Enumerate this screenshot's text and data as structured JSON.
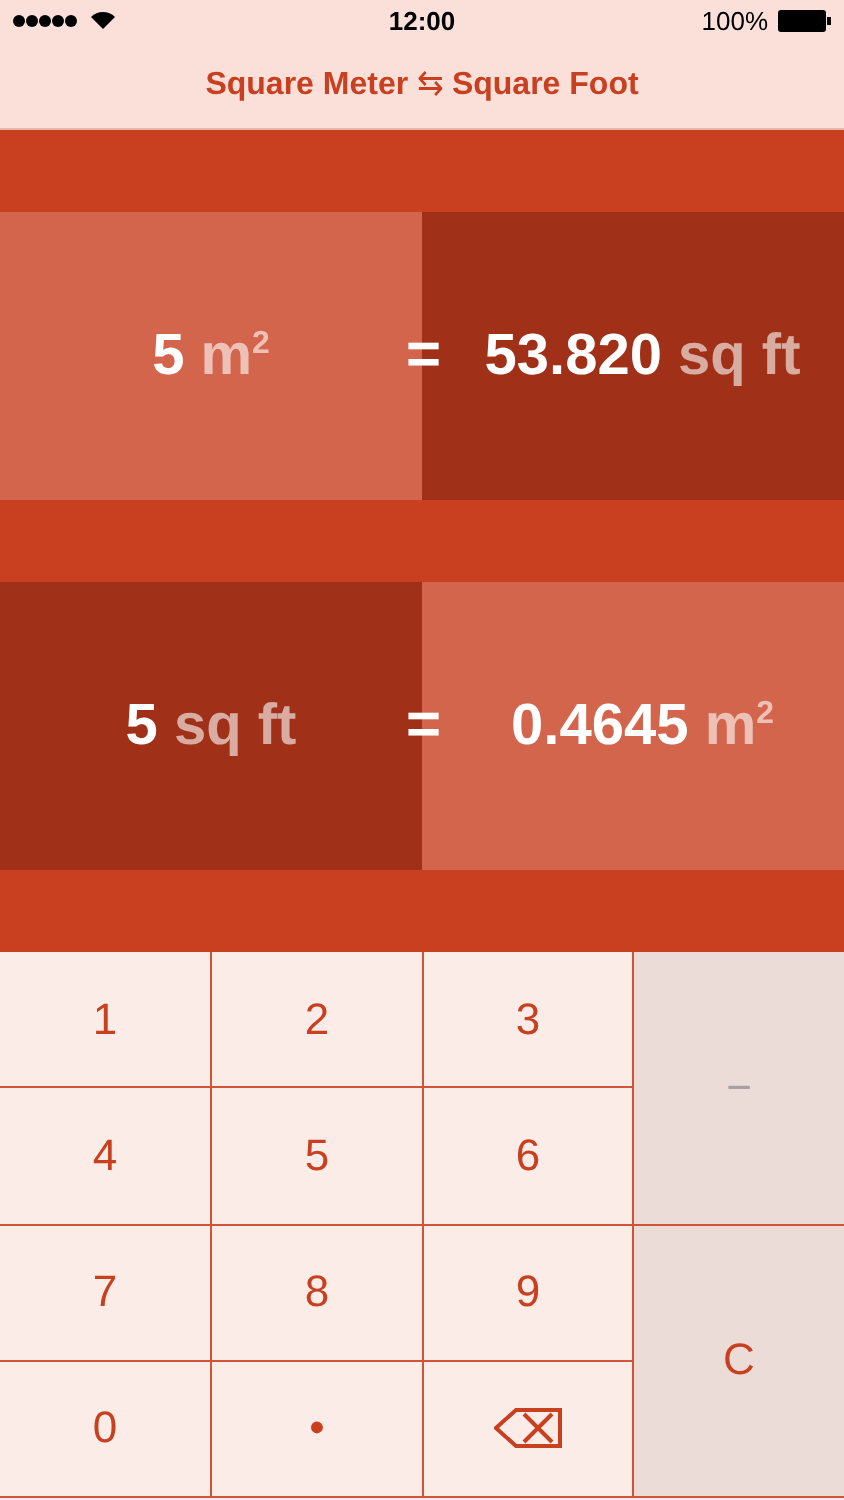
{
  "status_bar": {
    "time": "12:00",
    "battery": "100%"
  },
  "nav": {
    "from": "Square Meter",
    "arrow": "⇆",
    "to": "Square Foot"
  },
  "conversions": [
    {
      "inverted": false,
      "value": "5",
      "unit": "m$^{2}$",
      "equals": "=",
      "result": "53.820",
      "result_unit": "sq ft"
    },
    {
      "inverted": true,
      "value": "5",
      "unit": "sq ft",
      "equals": "=",
      "result": "0.4645",
      "result_unit": "m$^{2}$"
    }
  ],
  "keypad": [
    {
      "kind": "digit",
      "label": "1",
      "disabled": false
    },
    {
      "kind": "digit",
      "label": "2",
      "disabled": false
    },
    {
      "kind": "digit",
      "label": "3",
      "disabled": false
    },
    {
      "kind": "side",
      "label": "−",
      "disabled": true
    },
    {
      "kind": "digit",
      "label": "4",
      "disabled": false
    },
    {
      "kind": "digit",
      "label": "5",
      "disabled": false
    },
    {
      "kind": "digit",
      "label": "6",
      "disabled": false
    },
    {
      "kind": "digit",
      "label": "7",
      "disabled": false
    },
    {
      "kind": "digit",
      "label": "8",
      "disabled": false
    },
    {
      "kind": "digit",
      "label": "9",
      "disabled": false
    },
    {
      "kind": "side",
      "label": "C",
      "disabled": false
    },
    {
      "kind": "digit",
      "label": "0",
      "disabled": false
    },
    {
      "kind": "digit",
      "label": "•",
      "disabled": false
    },
    {
      "kind": "backspace",
      "disabled": false
    }
  ]
}
